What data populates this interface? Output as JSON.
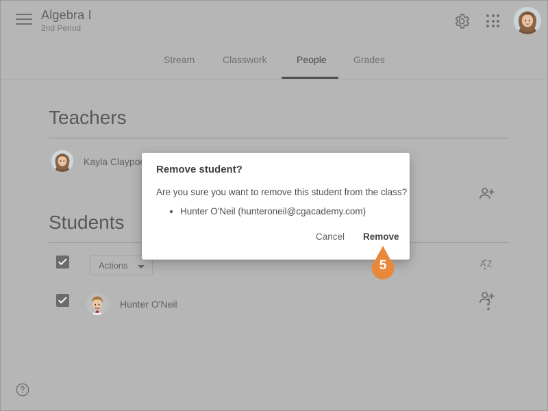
{
  "header": {
    "menu_icon": "hamburger-menu-icon",
    "class_name": "Algebra I",
    "class_period": "2nd Period",
    "settings_icon": "gear-icon",
    "apps_icon": "apps-grid-icon",
    "account_icon": "user-avatar"
  },
  "tabs": [
    {
      "label": "Stream",
      "active": false
    },
    {
      "label": "Classwork",
      "active": false
    },
    {
      "label": "People",
      "active": true
    },
    {
      "label": "Grades",
      "active": false
    }
  ],
  "teachers": {
    "title": "Teachers",
    "invite_icon": "invite-teacher-icon",
    "list": [
      {
        "name": "Kayla Claypoole"
      }
    ]
  },
  "students": {
    "title": "Students",
    "invite_icon": "invite-student-icon",
    "sort_icon": "sort-az-icon",
    "select_all_checked": true,
    "actions_label": "Actions",
    "actions_caret_icon": "chevron-down-icon",
    "list": [
      {
        "name": "Hunter O'Neil",
        "checked": true,
        "overflow_icon": "more-vert-icon"
      }
    ]
  },
  "footer": {
    "help_icon": "help-circle-icon"
  },
  "dialog": {
    "title": "Remove student?",
    "message": "Are you sure you want to remove this student from the class?",
    "items": [
      "Hunter O'Neil (hunteroneil@cgacademy.com)"
    ],
    "cancel_label": "Cancel",
    "confirm_label": "Remove"
  },
  "step_marker": {
    "number": "5",
    "color": "#e8883a"
  },
  "colors": {
    "page_dim": "#b6b6b6",
    "dialog_bg": "#ffffff",
    "text_primary": "#3c4043",
    "text_secondary": "#5d6065",
    "accent_orange": "#e8883a"
  }
}
